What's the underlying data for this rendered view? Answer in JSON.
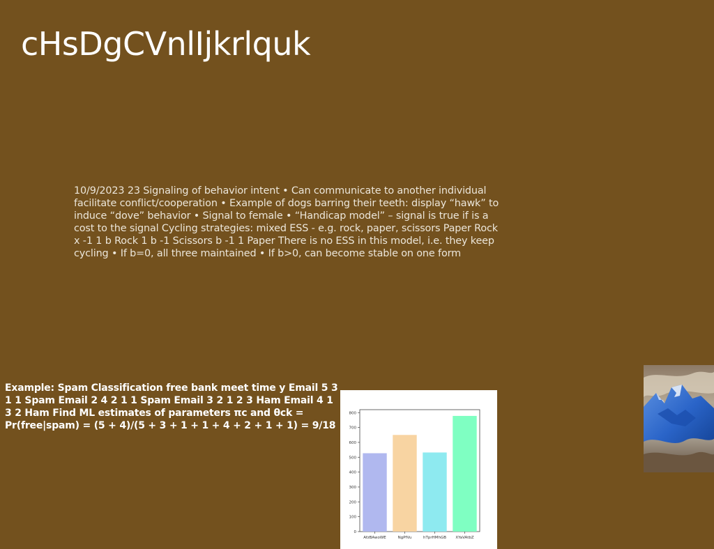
{
  "slide": {
    "title": "cHsDgCVnlIjkrlquk",
    "body_text": "10/9/2023 23 Signaling of behavior intent • Can communicate to another individual facilitate conflict/cooperation • Example of dogs barring their teeth: display “hawk” to induce “dove” behavior • Signal to female • “Handicap model” – signal is true if is a cost to the signal Cycling strategies: mixed ESS - e.g. rock, paper, scissors Paper Rock x -1 1 b Rock 1 b -1 Scissors b -1 1 Paper There is no ESS in this model, i.e. they keep cycling • If b=0, all three maintained • If b>0, can become stable on one form",
    "spam_text": "Example: Spam Classification free bank meet time y Email 5 3 1 1 Spam Email 2 4 2 1 1 Spam Email 3 2 1 2 3 Ham Email 4 1 3 2 Ham Find ML estimates of parameters πc and θck = Pr(free|spam) = (5 + 4)/(5 + 3 + 1 + 1 + 4 + 2 + 1 + 1) = 9/18"
  },
  "colors": {
    "background": "#73511e",
    "title": "#ffffff",
    "body_text": "#ece6da"
  },
  "chart_data": {
    "type": "bar",
    "title": "",
    "xlabel": "",
    "ylabel": "",
    "categories": [
      "AfzBAwoWE",
      "NgPfVu",
      "hTprHMhGB",
      "XYaVAtbZ"
    ],
    "values": [
      527,
      650,
      532,
      778
    ],
    "colors": [
      "#b0b8ef",
      "#f8d4a2",
      "#8eeaf0",
      "#7fffc2"
    ],
    "ylim": [
      0,
      820
    ],
    "yticks": [
      0,
      100,
      200,
      300,
      400,
      500,
      600,
      700,
      800
    ],
    "grid": false
  },
  "photo": {
    "subject": "snow-capped blue mountain peak"
  }
}
